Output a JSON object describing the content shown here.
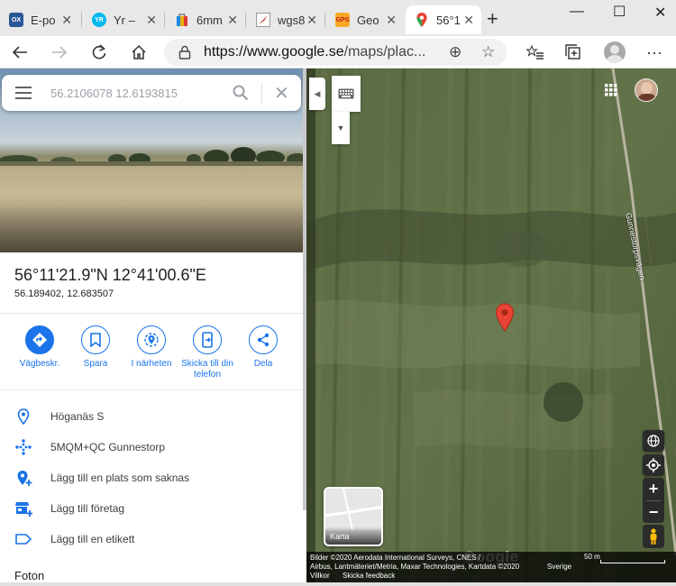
{
  "browser": {
    "tabs": [
      {
        "label": "E-po",
        "icon": "ox-icon",
        "fav_text": "OX",
        "fav_color": "#2b5797"
      },
      {
        "label": "Yr –",
        "icon": "yr-icon",
        "fav_text": "YR",
        "fav_color": "#00b8f1"
      },
      {
        "label": "6mm",
        "icon": "shopping-bag-icon",
        "fav_text": "",
        "fav_color": "#e8b100"
      },
      {
        "label": "wgs8",
        "icon": "compass-icon",
        "fav_text": "",
        "fav_color": "#c62828"
      },
      {
        "label": "Geo",
        "icon": "gps-icon",
        "fav_text": "GPS",
        "fav_color": "#f9a825"
      },
      {
        "label": "56°1",
        "icon": "google-maps-icon",
        "fav_text": "",
        "fav_color": "#34a853"
      }
    ],
    "url_host": "https://www.google.se",
    "url_path": "/maps/plac..."
  },
  "search": {
    "value": "56.2106078 12.6193815"
  },
  "place": {
    "title": "56°11'21.9\"N 12°41'00.6\"E",
    "decimal": "56.189402, 12.683507"
  },
  "actions": [
    {
      "label": "Vägbeskr.",
      "icon": "directions-icon"
    },
    {
      "label": "Spara",
      "icon": "bookmark-icon"
    },
    {
      "label": "I närheten",
      "icon": "nearby-icon"
    },
    {
      "label": "Skicka till din telefon",
      "icon": "send-to-phone-icon"
    },
    {
      "label": "Dela",
      "icon": "share-icon"
    }
  ],
  "info_rows": [
    {
      "text": "Höganäs S",
      "icon": "location-pin-icon"
    },
    {
      "text": "5MQM+QC Gunnestorp",
      "icon": "plus-code-icon"
    },
    {
      "text": "Lägg till en plats som saknas",
      "icon": "add-place-icon"
    },
    {
      "text": "Lägg till företag",
      "icon": "add-business-icon"
    },
    {
      "text": "Lägg till en etikett",
      "icon": "label-icon"
    }
  ],
  "section_photos": "Foton",
  "map": {
    "road_label": "Gunnestorpsvägen",
    "layer_label": "Karta",
    "google_logo": "Google",
    "attribution_1": "Bilder ©2020 Aerodata International Surveys, CNES /",
    "attribution_2": "Airbus, Lantmäteriet/Metria, Maxar Technologies, Kartdata ©2020",
    "attribution_3": "Villkor",
    "country": "Sverige",
    "feedback": "Skicka feedback",
    "scale": "50 m"
  }
}
